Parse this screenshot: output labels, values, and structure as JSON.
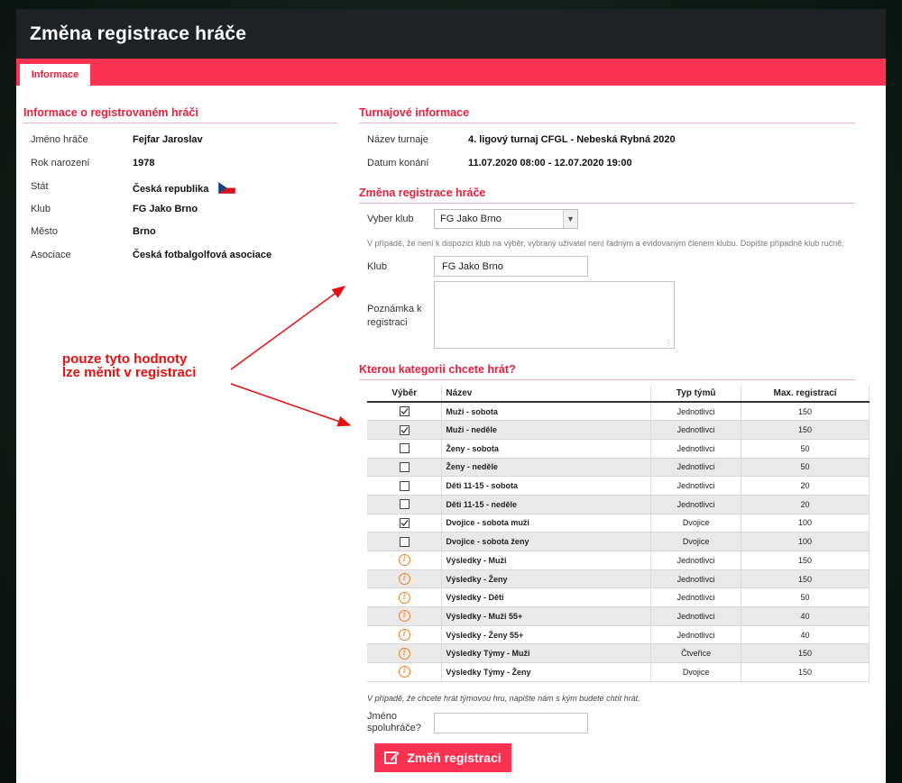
{
  "modal": {
    "title": "Změna registrace hráče",
    "tab_label": "Informace"
  },
  "player_info": {
    "section_title": "Informace o registrovaném hráči",
    "rows": [
      {
        "label": "Jméno hráče",
        "value": "Fejfar Jaroslav"
      },
      {
        "label": "Rok narození",
        "value": "1978"
      },
      {
        "label": "Stát",
        "value": "Česká republika"
      },
      {
        "label": "Klub",
        "value": "FG Jako Brno"
      },
      {
        "label": "Město",
        "value": "Brno"
      },
      {
        "label": "Asociace",
        "value": "Česká fotbalgolfová asociace"
      }
    ],
    "flag_icon": "czech-flag-icon"
  },
  "tournament": {
    "section_title": "Turnajové informace",
    "rows": [
      {
        "label": "Název turnaje",
        "value": "4. ligový turnaj CFGL - Nebeská Rybná 2020"
      },
      {
        "label": "Datum konání",
        "value": "11.07.2020 08:00 - 12.07.2020 19:00"
      }
    ]
  },
  "change": {
    "section_title": "Změna registrace hráče",
    "club_select_label": "Vyber klub",
    "club_select_value": "FG Jako Brno",
    "club_hint": "V případě, že není k dispozici klub na výběr, vybraný uživatel není řádným a evidovaným členem klubu. Dopište případně klub ručně.",
    "club_label": "Klub",
    "club_value": "FG Jako Brno",
    "note_label": "Poznámka k registraci",
    "note_value": ""
  },
  "categories": {
    "section_title": "Kterou kategorii chcete hrát?",
    "headers": {
      "select": "Výběr",
      "name": "Název",
      "type": "Typ týmů",
      "max": "Max. registrací"
    },
    "rows": [
      {
        "state": "checked",
        "name": "Muži - sobota",
        "type": "Jednotlivci",
        "max": "150"
      },
      {
        "state": "checked",
        "name": "Muži - neděle",
        "type": "Jednotlivci",
        "max": "150"
      },
      {
        "state": "unchecked",
        "name": "Ženy - sobota",
        "type": "Jednotlivci",
        "max": "50"
      },
      {
        "state": "unchecked",
        "name": "Ženy - neděle",
        "type": "Jednotlivci",
        "max": "50"
      },
      {
        "state": "unchecked",
        "name": "Děti 11-15 - sobota",
        "type": "Jednotlivci",
        "max": "20"
      },
      {
        "state": "unchecked",
        "name": "Děti 11-15 - neděle",
        "type": "Jednotlivci",
        "max": "20"
      },
      {
        "state": "checked",
        "name": "Dvojice - sobota muži",
        "type": "Dvojice",
        "max": "100"
      },
      {
        "state": "unchecked",
        "name": "Dvojice - sobota ženy",
        "type": "Dvojice",
        "max": "100"
      },
      {
        "state": "info",
        "name": "Výsledky - Muži",
        "type": "Jednotlivci",
        "max": "150"
      },
      {
        "state": "info",
        "name": "Výsledky - Ženy",
        "type": "Jednotlivci",
        "max": "150"
      },
      {
        "state": "info",
        "name": "Výsledky - Děti",
        "type": "Jednotlivci",
        "max": "50"
      },
      {
        "state": "info",
        "name": "Výsledky - Muži 55+",
        "type": "Jednotlivci",
        "max": "40"
      },
      {
        "state": "info",
        "name": "Výsledky - Ženy 55+",
        "type": "Jednotlivci",
        "max": "40"
      },
      {
        "state": "info",
        "name": "Výsledky Týmy - Muži",
        "type": "Čtveřice",
        "max": "150"
      },
      {
        "state": "info",
        "name": "Výsledky Týmy - Ženy",
        "type": "Dvojice",
        "max": "150"
      }
    ],
    "team_hint": "V případě, že chcete hrát týmovou hru, napište nám s kým budete chtít hrát.",
    "partner_label": "Jméno spoluhráče?",
    "partner_value": ""
  },
  "submit": {
    "label": "Změň registraci",
    "icon": "edit-icon"
  },
  "annotation": {
    "line1": "pouze tyto hodnoty",
    "line2": "lze měnit v registraci",
    "color": "#e51010"
  },
  "colors": {
    "accent": "#fa3353",
    "header_bg": "#1f2225",
    "info_icon": "#f08020"
  }
}
